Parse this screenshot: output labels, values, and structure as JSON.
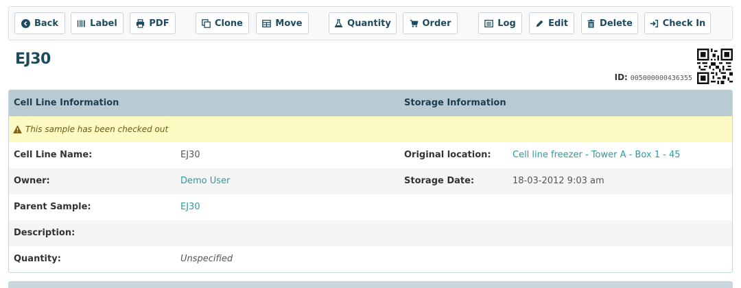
{
  "toolbar": {
    "back": "Back",
    "label": "Label",
    "pdf": "PDF",
    "clone": "Clone",
    "move": "Move",
    "quantity": "Quantity",
    "order": "Order",
    "log": "Log",
    "edit": "Edit",
    "delete": "Delete",
    "check_in": "Check In"
  },
  "sample": {
    "title": "EJ30",
    "id_label": "ID:",
    "id_value": "005000000436355"
  },
  "panel": {
    "left_header": "Cell Line Information",
    "right_header": "Storage Information",
    "alert": "This sample has been checked out",
    "fields": {
      "cell_line_name_label": "Cell Line Name:",
      "cell_line_name_value": "EJ30",
      "owner_label": "Owner:",
      "owner_value": "Demo User",
      "parent_sample_label": "Parent Sample:",
      "parent_sample_value": "EJ30",
      "description_label": "Description:",
      "description_value": "",
      "quantity_label": "Quantity:",
      "quantity_value": "Unspecified",
      "original_location_label": "Original location:",
      "original_location_value": "Cell line freezer - Tower A - Box 1 - 45",
      "storage_date_label": "Storage Date:",
      "storage_date_value": "18-03-2012 9:03 am"
    }
  },
  "colors": {
    "accent_text": "#1c4a5e",
    "link": "#2e9a9a",
    "header_bg": "#b8cbd3",
    "alert_bg": "#fdfac4"
  }
}
